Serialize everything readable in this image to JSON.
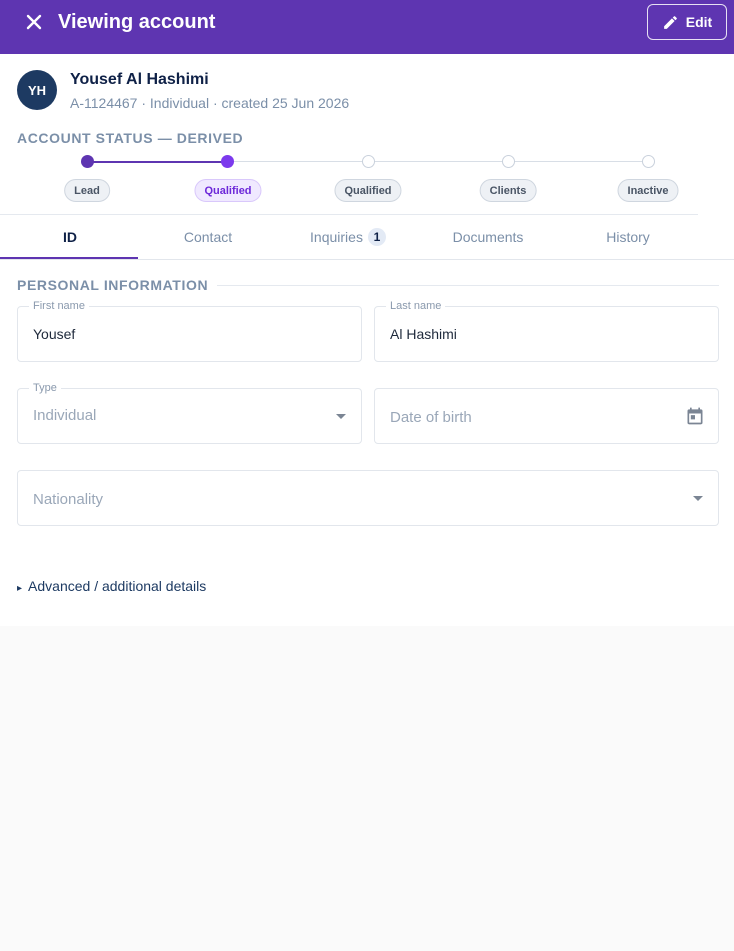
{
  "header": {
    "title": "Viewing account",
    "edit_label": "Edit",
    "background": "#5e35b1"
  },
  "account": {
    "initials": "YH",
    "name": "Yousef Al Hashimi",
    "meta": "A-1124467 · Individual · created 25 Jun 2026"
  },
  "status": {
    "label": "ACCOUNT STATUS — DERIVED",
    "current_index": 1,
    "steps": [
      {
        "label": "Lead",
        "state": "done"
      },
      {
        "label": "Qualified",
        "state": "current"
      },
      {
        "label": "Qualified",
        "state": "pending"
      },
      {
        "label": "Clients",
        "state": "pending"
      },
      {
        "label": "Inactive",
        "state": "pending"
      }
    ]
  },
  "tabs": [
    {
      "label": "ID",
      "active": true
    },
    {
      "label": "Contact"
    },
    {
      "label": "Inquiries",
      "badge": "1"
    },
    {
      "label": "Documents"
    },
    {
      "label": "History"
    }
  ],
  "personal": {
    "label": "PERSONAL INFORMATION",
    "first_name": {
      "label": "First name",
      "value": "Yousef"
    },
    "last_name": {
      "label": "Last name",
      "value": "Al Hashimi"
    },
    "type": {
      "label": "Type",
      "value": "Individual"
    },
    "dob": {
      "placeholder": "Date of birth"
    },
    "nationality": {
      "placeholder": "Nationality"
    }
  },
  "advanced": {
    "label": "Advanced / additional details"
  },
  "icons": {
    "close": "close-icon",
    "edit": "pencil-icon",
    "calendar": "calendar-icon",
    "dropdown": "chevron-down-icon",
    "disclosure": "triangle-right-icon"
  }
}
